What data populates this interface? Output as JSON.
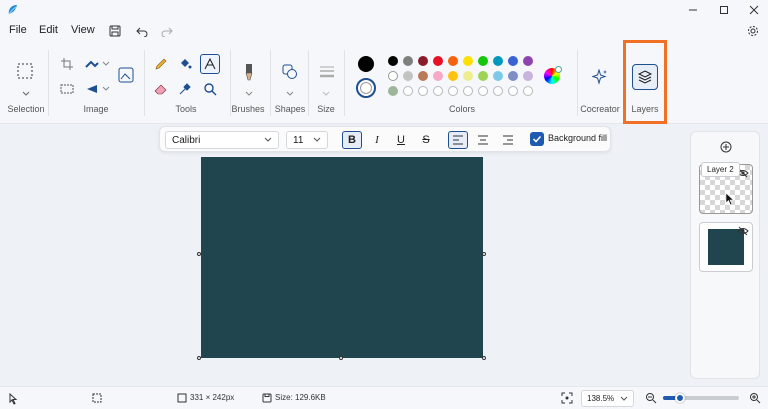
{
  "menu": {
    "file": "File",
    "edit": "Edit",
    "view": "View"
  },
  "groups": {
    "selection": "Selection",
    "image": "Image",
    "tools": "Tools",
    "brushes": "Brushes",
    "shapes": "Shapes",
    "size": "Size",
    "colors": "Colors",
    "cocreator": "Cocreator",
    "layers": "Layers"
  },
  "text_toolbar": {
    "font": "Calibri",
    "font_size": "11",
    "bold": "B",
    "italic": "I",
    "underline": "U",
    "strike": "S",
    "background_fill": "Background fill"
  },
  "layers": {
    "tooltip": "Layer 2"
  },
  "status": {
    "dimensions": "331 × 242px",
    "size": "Size: 129.6KB",
    "zoom": "138.5%"
  },
  "colors": {
    "primary": "#000000",
    "secondary": "#ffffff",
    "canvas_fill": "#21454f",
    "highlight": "#f07125",
    "row1": [
      "#000000",
      "#7f7f7f",
      "#8b1a2b",
      "#e81123",
      "#f7630c",
      "#fce100",
      "#16c60c",
      "#0099bc",
      "#3a62d4",
      "#8e44ad"
    ],
    "row2": [
      "#ffffff",
      "#c3c3c3",
      "#b97a57",
      "#f7a8c4",
      "#ffc20e",
      "#eded8f",
      "#9fd356",
      "#7fc9e8",
      "#7f8fc4",
      "#c8b3dc"
    ],
    "row3": [
      "#9fb59a"
    ]
  }
}
